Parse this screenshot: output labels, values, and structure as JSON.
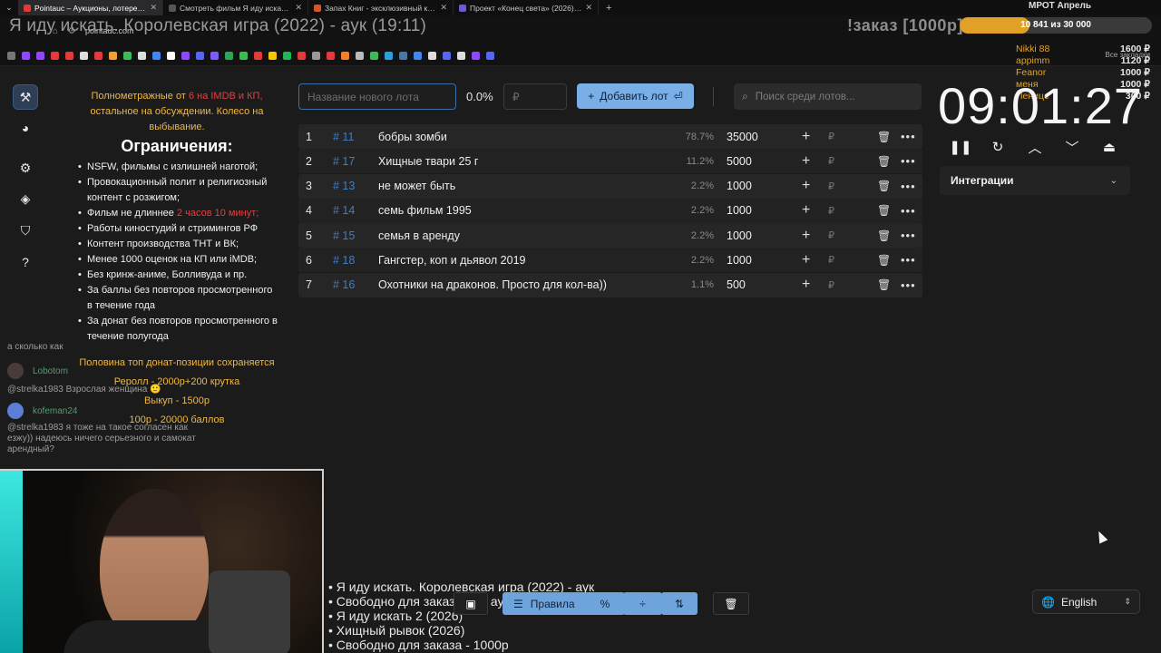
{
  "browser": {
    "tabs": [
      {
        "label": "Pointauc – Аукционы, лотере…",
        "color": "#e23a3a",
        "active": true
      },
      {
        "label": "Смотреть фильм Я иду искать…",
        "color": "#555555",
        "active": false
      },
      {
        "label": "Запах Книг - эксклюзивный к…",
        "color": "#d9532a",
        "active": false
      },
      {
        "label": "Проект «Конец света» (2026)…",
        "color": "#6a5cd6",
        "active": false
      }
    ],
    "url": "pointauc.com",
    "all_bookmarks": "Все закладки"
  },
  "overlay": {
    "stream_title": "Я иду искать. Королевская игра (2022) - аук (19:11)",
    "order_label": "!заказ [1000р]",
    "mrot_title": "МРОТ Апрель",
    "goal_text": "10 841  из 30 000",
    "goal_fraction": 0.361,
    "donors": [
      {
        "name": "Nikki 88",
        "amount": "1600 ₽"
      },
      {
        "name": "appimm",
        "amount": "1120 ₽"
      },
      {
        "name": "Feanor",
        "amount": "1000 ₽"
      },
      {
        "name": "меня",
        "amount": "1000 ₽"
      },
      {
        "name": "Пенице",
        "amount": "300 ₽"
      }
    ]
  },
  "rules": {
    "intro_a": "Полнометражные от ",
    "intro_red": "6 на IMDB и КП,",
    "intro_b": " остальное на обсуждении. Колесо на выбывание.",
    "heading": "Ограничения:",
    "items": [
      "NSFW, фильмы с излишней наготой;",
      "Провокационный полит и религиозный контент с розжигом;",
      "Фильм не длиннее ",
      "Работы киностудий и стримингов РФ",
      "Контент производства ТНТ и ВК;",
      "Менее 1000 оценок на КП или iMDB;",
      "Без кринж-аниме, Болливуда и пр.",
      "За баллы без повторов просмотренного в течение года",
      "За донат без повторов просмотренного в течение полугода"
    ],
    "item3_red": "2 часов 10 минут;",
    "footer": [
      "Половина топ донат-позиции сохраняется",
      "Реролл - 2000р+200 крутка",
      "Выкуп - 1500р",
      "100р - 20000 баллов"
    ]
  },
  "chat": [
    {
      "nick": "",
      "text": "а сколько как"
    },
    {
      "nick": "Lobotom",
      "text": "@strelka1983 Взрослая женщина 🙂"
    },
    {
      "nick": "kofeman24",
      "text": "@strelka1983 я тоже на такое согласен как езжу)) надеюсь ничего серьезного и самокат арендный?"
    }
  ],
  "auction": {
    "new_lot_placeholder": "Название нового лота",
    "percent": "0.0%",
    "amount_placeholder": "₽",
    "add_button": "Добавить лот",
    "search_placeholder": "Поиск среди лотов...",
    "lots": [
      {
        "num": "1",
        "id": "# 11",
        "name": "бобры зомби",
        "pct": "78.7%",
        "amount": "35000"
      },
      {
        "num": "2",
        "id": "# 17",
        "name": "Хищные твари 25 г",
        "pct": "11.2%",
        "amount": "5000"
      },
      {
        "num": "3",
        "id": "# 13",
        "name": "не может быть",
        "pct": "2.2%",
        "amount": "1000"
      },
      {
        "num": "4",
        "id": "# 14",
        "name": "семь фильм 1995",
        "pct": "2.2%",
        "amount": "1000"
      },
      {
        "num": "5",
        "id": "# 15",
        "name": "семья в аренду",
        "pct": "2.2%",
        "amount": "1000"
      },
      {
        "num": "6",
        "id": "# 18",
        "name": "Гангстер, коп и дьявол 2019",
        "pct": "2.2%",
        "amount": "1000"
      },
      {
        "num": "7",
        "id": "# 16",
        "name": "Охотники на драконов.  Просто для кол-ва))",
        "pct": "1.1%",
        "amount": "500"
      }
    ],
    "currency_symbol": "₽"
  },
  "timer": {
    "display": "09:01:27",
    "integrations_label": "Интеграции"
  },
  "queue": [
    "• Я иду искать. Королевская игра (2022) - аук",
    "• Свободно для заказа или аук",
    "• Я иду искать 2 (2026)",
    "• Хищный рывок (2026)",
    "• Свободно для заказа - 1000р"
  ],
  "toolbar": {
    "rules_label": "Правила"
  },
  "language": {
    "selected": "English"
  }
}
